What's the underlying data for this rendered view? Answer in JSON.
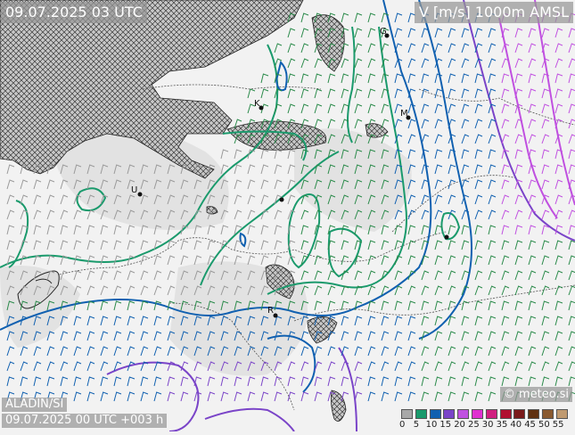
{
  "header": {
    "valid_time": "09.07.2025 03 UTC",
    "field_title": "V [m/s] 1000m AMSL"
  },
  "footer": {
    "model": "ALADIN/SI",
    "run": "09.07.2025 00 UTC +003 h",
    "copyright": "© meteo.si"
  },
  "legend": {
    "ticks": [
      "0",
      "5",
      "10",
      "15",
      "20",
      "25",
      "30",
      "35",
      "40",
      "45",
      "50",
      "55"
    ],
    "colors": [
      "#a8a8a8",
      "#1a9a6c",
      "#1060b0",
      "#7a44c8",
      "#c050e0",
      "#e030d0",
      "#d02080",
      "#b01030",
      "#7a1a1a",
      "#603010",
      "#8a5a30",
      "#c09a70"
    ]
  },
  "cities": [
    {
      "label": "G"
    },
    {
      "label": "K"
    },
    {
      "label": "M"
    },
    {
      "label": "U"
    },
    {
      "label": "R"
    },
    {
      "label": ""
    },
    {
      "label": ""
    }
  ],
  "map_colors": {
    "background": "#f2f2f2",
    "sea_hatch": "#3a3a3a",
    "barb": "#2a8a4a"
  }
}
